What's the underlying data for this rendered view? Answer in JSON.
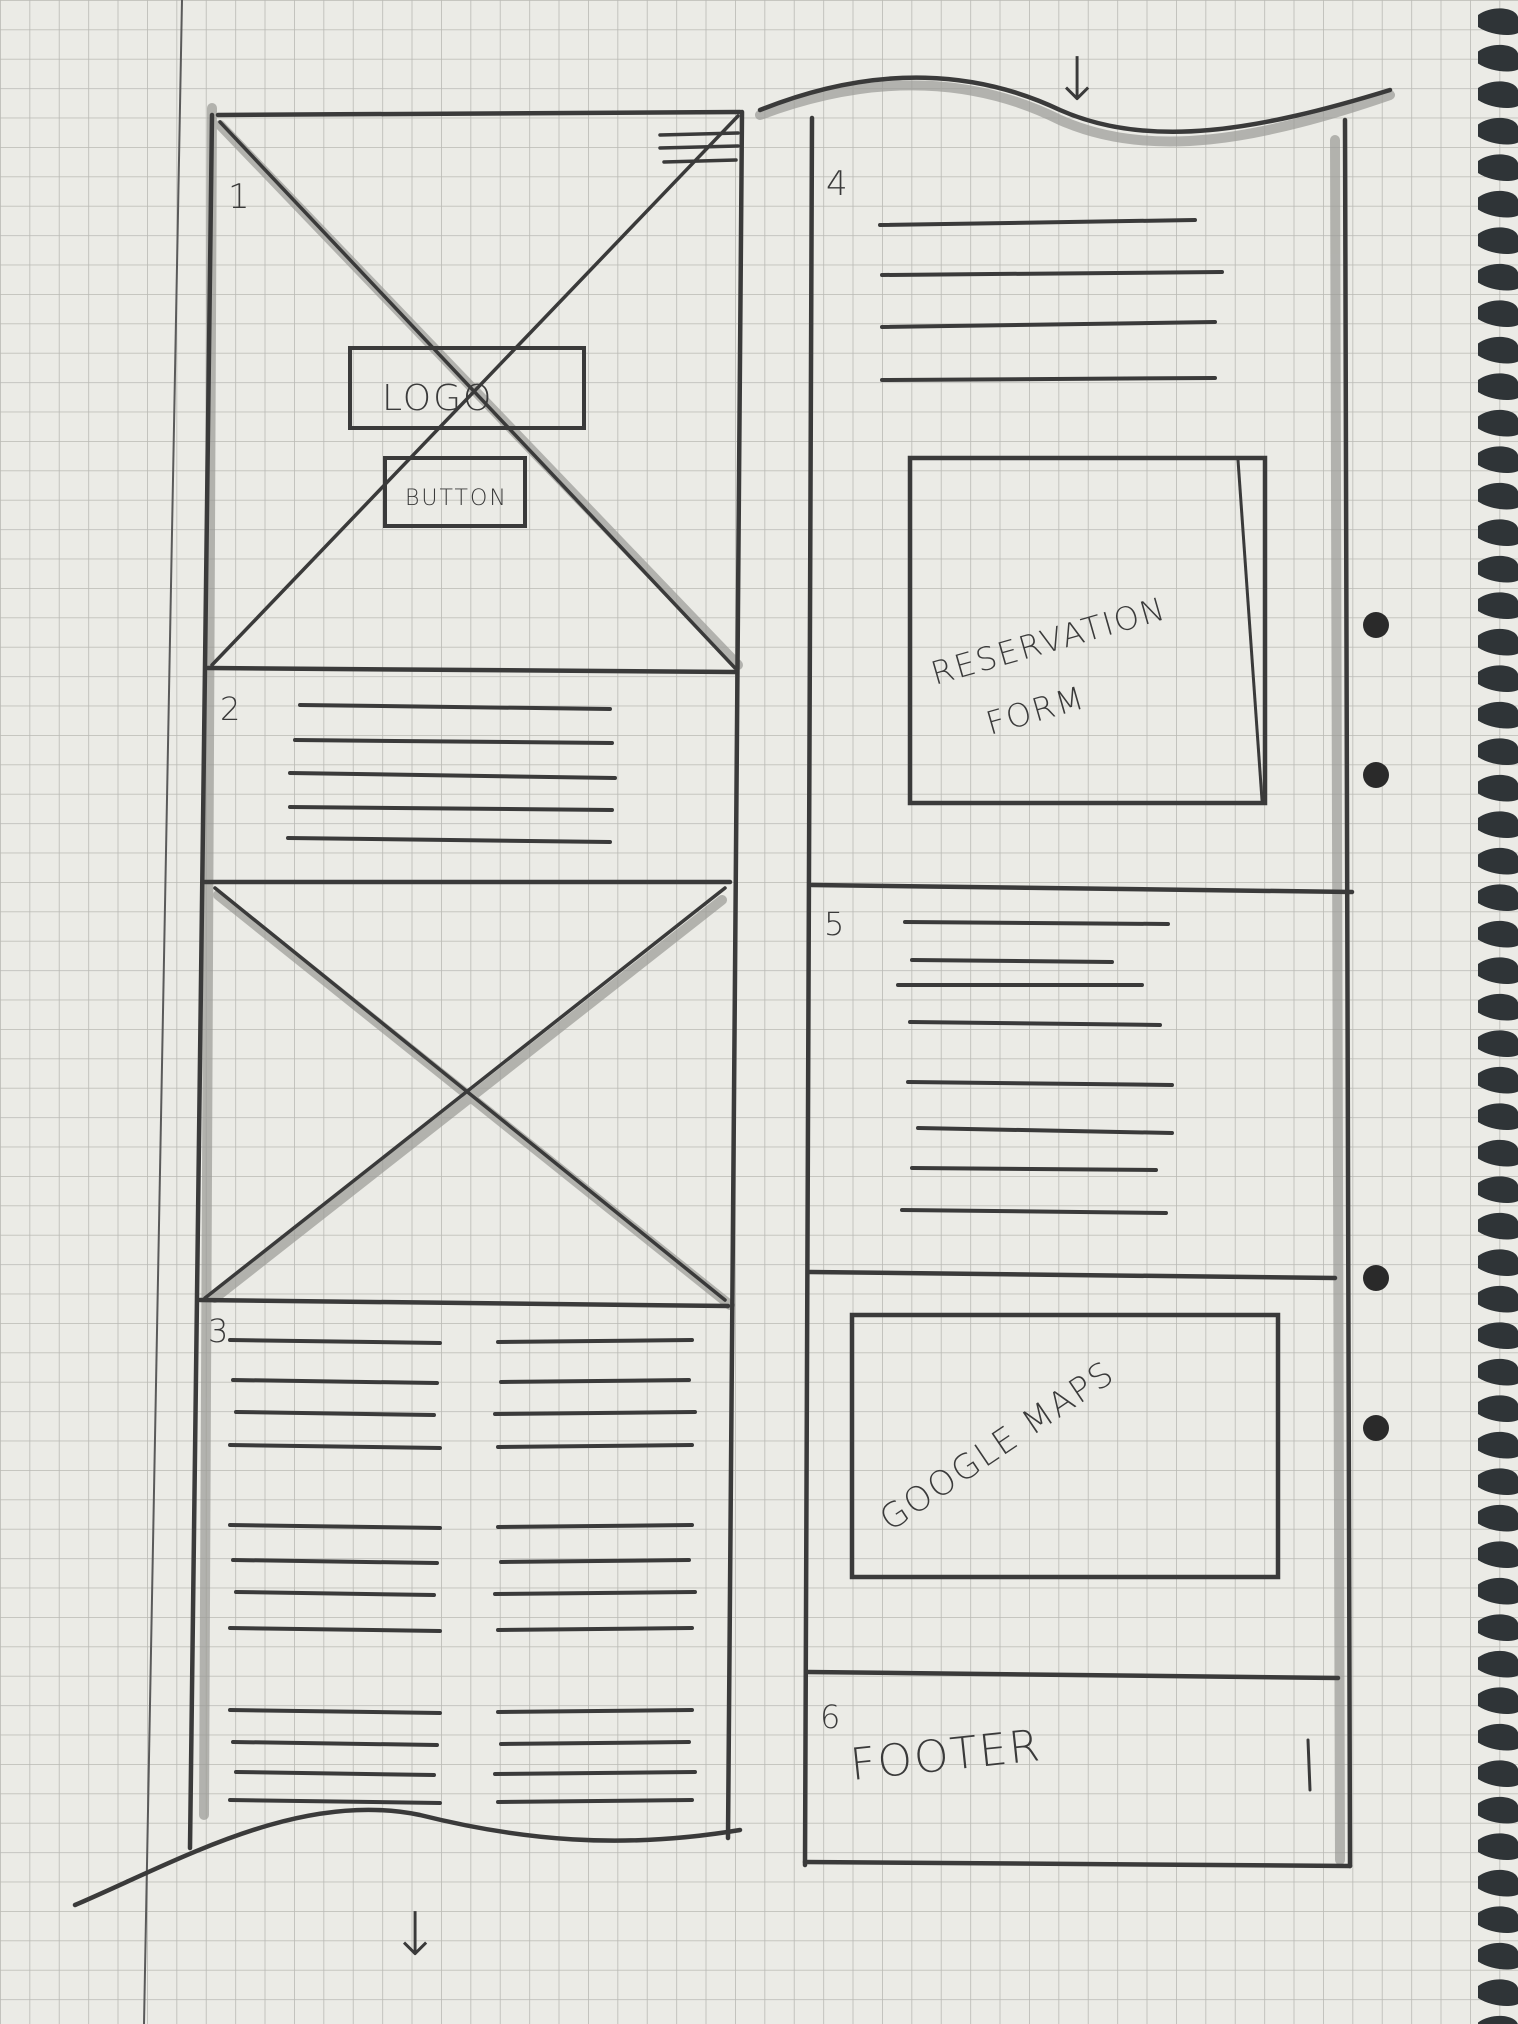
{
  "paper": {
    "background": "#ebebe6",
    "grid_color": "#b9b9b4",
    "ink": "#3a3a3a",
    "ink_shadow": "#9a9a96",
    "spiral_color": "#2f3437"
  },
  "column_left": {
    "section_1": {
      "number": "1",
      "logo_label": "LOGO",
      "button_label": "BUTTON"
    },
    "section_2": {
      "number": "2"
    },
    "section_3": {
      "number": "3"
    },
    "scroll_arrow": "↓"
  },
  "column_right": {
    "scroll_arrow": "↓",
    "section_4": {
      "number": "4",
      "form_label_line1": "RESERVATION",
      "form_label_line2": "FORM"
    },
    "section_5": {
      "number": "5"
    },
    "map_label": "GOOGLE MAPS",
    "section_6": {
      "number": "6",
      "footer_label": "FOOTER"
    }
  }
}
